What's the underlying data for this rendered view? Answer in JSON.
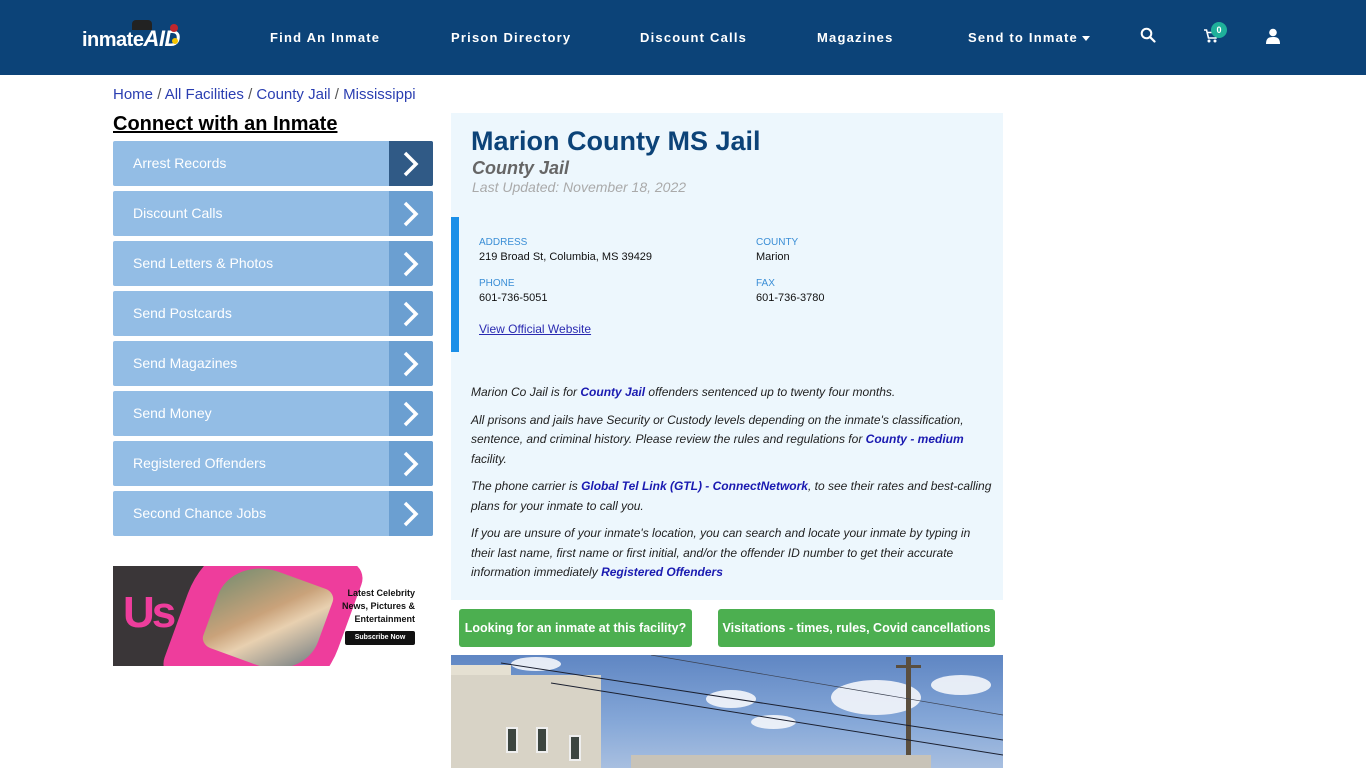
{
  "header": {
    "logo_text": "inmate",
    "logo_text_2": "AID",
    "nav": [
      "Find An Inmate",
      "Prison Directory",
      "Discount Calls",
      "Magazines",
      "Send to Inmate"
    ],
    "cart_count": "0",
    "icons": [
      "search-icon",
      "cart-icon",
      "user-icon"
    ]
  },
  "breadcrumb": [
    "Home",
    "All Facilities",
    "County Jail",
    "Mississippi"
  ],
  "sidebar": {
    "title": "Connect with an Inmate",
    "items": [
      {
        "label": "Arrest Records"
      },
      {
        "label": "Discount Calls"
      },
      {
        "label": "Send Letters & Photos"
      },
      {
        "label": "Send Postcards"
      },
      {
        "label": "Send Magazines"
      },
      {
        "label": "Send Money"
      },
      {
        "label": "Registered Offenders"
      },
      {
        "label": "Second Chance Jobs"
      }
    ],
    "ad": {
      "brand": "Us",
      "line1": "Latest Celebrity",
      "line2": "News, Pictures &",
      "line3": "Entertainment",
      "cta": "Subscribe Now"
    }
  },
  "facility": {
    "name": "Marion County MS Jail",
    "type": "County Jail",
    "last_updated": "Last Updated: November 18, 2022",
    "address_label": "ADDRESS",
    "address": "219 Broad St, Columbia, MS 39429",
    "county_label": "COUNTY",
    "county": "Marion",
    "phone_label": "PHONE",
    "phone": "601-736-5051",
    "fax_label": "FAX",
    "fax": "601-736-3780",
    "website_link": "View Official Website"
  },
  "description": {
    "p1_a": "Marion Co Jail is for ",
    "p1_link": "County Jail",
    "p1_b": " offenders sentenced up to twenty four months.",
    "p2_a": "All prisons and jails have Security or Custody levels depending on the inmate's classification, sentence, and criminal history. Please review the rules and regulations for ",
    "p2_link": "County - medium",
    "p2_b": " facility.",
    "p3_a": "The phone carrier is ",
    "p3_link": "Global Tel Link (GTL) - ConnectNetwork",
    "p3_b": ", to see their rates and best-calling plans for your inmate to call you.",
    "p4_a": "If you are unsure of your inmate's location, you can search and locate your inmate by typing in their last name, first name or first initial, and/or the offender ID number to get their accurate information immediately ",
    "p4_link": "Registered Offenders"
  },
  "buttons": {
    "find_inmate": "Looking for an inmate at this facility?",
    "visitation": "Visitations - times, rules, Covid cancellations"
  },
  "colors": {
    "header_bg": "#0c4378",
    "sidebar_item": "#93bde5",
    "sidebar_arrow": "#6b9fd1",
    "accent_green": "#4caf50",
    "panel_bg": "#edf7fd"
  }
}
